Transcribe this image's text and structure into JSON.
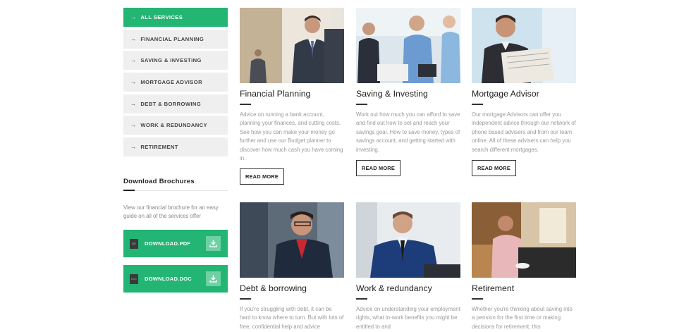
{
  "sidebar": {
    "items": [
      {
        "label": "ALL SERVICES",
        "active": true
      },
      {
        "label": "FINANCIAL PLANNING"
      },
      {
        "label": "SAVING & INVESTING"
      },
      {
        "label": "MORTGAGE ADVISOR"
      },
      {
        "label": "DEBT & BORROWING"
      },
      {
        "label": "WORK & REDUNDANCY"
      },
      {
        "label": "RETIREMENT"
      }
    ],
    "arrow": "→"
  },
  "brochures": {
    "title": "Download Brochures",
    "description": "View our financial brochure for an easy guide on all of the services offer",
    "pdf": {
      "label": "DOWNLOAD.PDF",
      "file_tag": "PDF"
    },
    "doc": {
      "label": "DOWNLOAD.DOC",
      "file_tag": "DOC"
    }
  },
  "cards": [
    {
      "title": "Financial Planning",
      "desc": "Advice on running a bank account, planning your finances, and cutting costs. See how you can make your money go further and use our Budget planner to discover how much cash you have coming in.",
      "button": "READ MORE"
    },
    {
      "title": "Saving & Investing",
      "desc": "Work out how much you can afford to save and find out how to set and reach your savings goal. How to save money, types of savings account, and getting started with investing.",
      "button": "READ MORE"
    },
    {
      "title": "Mortgage Advisor",
      "desc": "Our mortgage Advisors can offer you independent advice through our network of phone based advisers and from our team online. All of these advisers can help you search different mortgages.",
      "button": "READ MORE"
    },
    {
      "title": "Debt & borrowing",
      "desc": "If you're struggling with debt, it can be hard to know where to turn. But with lots of free, confidential help and advice"
    },
    {
      "title": "Work & redundancy",
      "desc": "Advice on understanding your employment rights, what in-work benefits you might be entitled to and"
    },
    {
      "title": "Retirement",
      "desc": "Whether you're thinking about saving into a pension for the first time or making decisions for retirement, this"
    }
  ],
  "colors": {
    "accent": "#22b573",
    "sidebar_bg": "#efefef"
  }
}
